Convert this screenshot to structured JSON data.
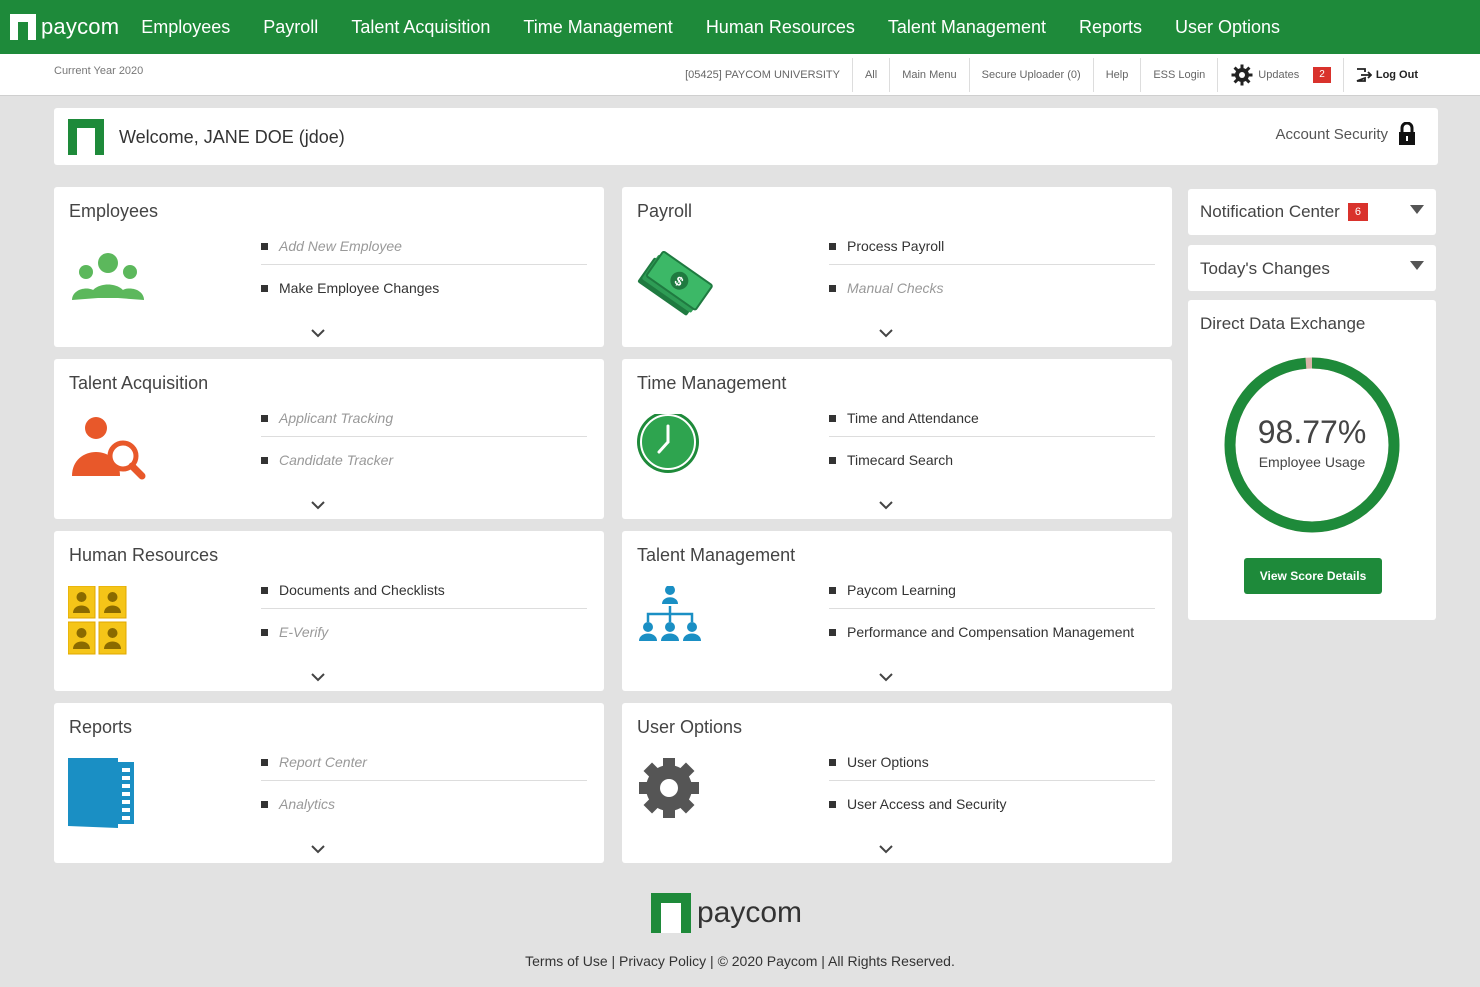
{
  "brand": {
    "name": "paycom",
    "green": "#1e8a3a",
    "red": "#d9322c"
  },
  "nav": [
    "Employees",
    "Payroll",
    "Talent Acquisition",
    "Time Management",
    "Human Resources",
    "Talent Management",
    "Reports",
    "User Options"
  ],
  "subbar": {
    "current_year": "Current Year 2020",
    "links": [
      "[05425] PAYCOM UNIVERSITY",
      "All",
      "Main Menu",
      "Secure Uploader (0)",
      "Help",
      "ESS Login"
    ],
    "updates_label": "Updates",
    "updates_count": "2",
    "logout_label": "Log Out"
  },
  "welcome": {
    "text": "Welcome, JANE DOE (jdoe)",
    "account_security": "Account Security"
  },
  "cards": [
    {
      "title": "Employees",
      "icon": "people-group-icon",
      "links": [
        {
          "label": "Add New Employee",
          "dim": true
        },
        {
          "label": "Make Employee Changes",
          "dim": false
        }
      ]
    },
    {
      "title": "Payroll",
      "icon": "money-stack-icon",
      "links": [
        {
          "label": "Process Payroll",
          "dim": false
        },
        {
          "label": "Manual Checks",
          "dim": true
        }
      ]
    },
    {
      "title": "Talent Acquisition",
      "icon": "person-search-icon",
      "links": [
        {
          "label": "Applicant Tracking",
          "dim": true
        },
        {
          "label": "Candidate Tracker",
          "dim": true
        }
      ]
    },
    {
      "title": "Time Management",
      "icon": "clock-icon",
      "links": [
        {
          "label": "Time and Attendance",
          "dim": false
        },
        {
          "label": "Timecard Search",
          "dim": false
        }
      ]
    },
    {
      "title": "Human Resources",
      "icon": "id-cards-icon",
      "links": [
        {
          "label": "Documents and Checklists",
          "dim": false
        },
        {
          "label": "E-Verify",
          "dim": true
        }
      ]
    },
    {
      "title": "Talent Management",
      "icon": "org-chart-icon",
      "links": [
        {
          "label": "Paycom Learning",
          "dim": false
        },
        {
          "label": "Performance and Compensation Management",
          "dim": false
        }
      ]
    },
    {
      "title": "Reports",
      "icon": "report-book-icon",
      "links": [
        {
          "label": "Report Center",
          "dim": true
        },
        {
          "label": "Analytics",
          "dim": true
        }
      ]
    },
    {
      "title": "User Options",
      "icon": "gear-icon",
      "links": [
        {
          "label": "User Options",
          "dim": false
        },
        {
          "label": "User Access and Security",
          "dim": false
        }
      ]
    }
  ],
  "right": {
    "notification_center": "Notification Center",
    "notification_count": "6",
    "todays_changes": "Today's Changes",
    "dde_title": "Direct Data Exchange",
    "score_value": "98.77%",
    "score_fraction": 0.9877,
    "score_label": "Employee Usage",
    "score_button": "View Score Details"
  },
  "footer": {
    "brand": "paycom",
    "text": "Terms of Use | Privacy Policy | © 2020 Paycom | All Rights Reserved."
  }
}
